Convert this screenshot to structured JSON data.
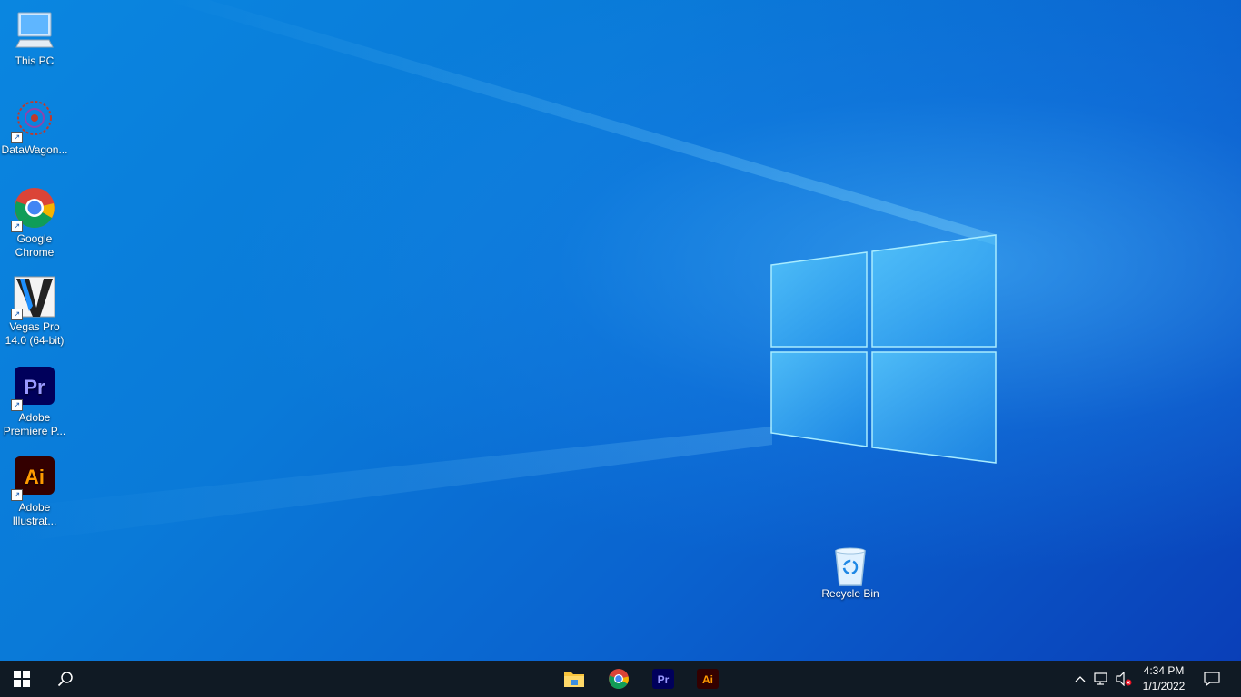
{
  "desktop": {
    "icons": [
      {
        "label": "This PC",
        "icon": "computer-icon"
      },
      {
        "label": "DataWagon...",
        "icon": "datawagon-icon"
      },
      {
        "label": "Google Chrome",
        "icon": "chrome-icon"
      },
      {
        "label": "Vegas Pro 14.0 (64-bit)",
        "icon": "vegas-pro-icon"
      },
      {
        "label": "Adobe Premiere P...",
        "icon": "premiere-pro-icon",
        "badge": "Pr",
        "color": "#9999ff"
      },
      {
        "label": "Adobe Illustrat...",
        "icon": "illustrator-icon",
        "badge": "Ai",
        "color": "#ff9a00"
      }
    ],
    "recycle_bin": {
      "label": "Recycle Bin",
      "icon": "recycle-bin-icon"
    }
  },
  "taskbar": {
    "apps": [
      {
        "name": "file-explorer",
        "icon": "folder-icon"
      },
      {
        "name": "chrome",
        "icon": "chrome-icon"
      },
      {
        "name": "premiere-pro",
        "icon": "premiere-pro-icon",
        "badge": "Pr"
      },
      {
        "name": "illustrator",
        "icon": "illustrator-icon",
        "badge": "Ai"
      }
    ],
    "tray": {
      "time": "4:34 PM",
      "date": "1/1/2022"
    }
  },
  "colors": {
    "taskbar": "#101a24",
    "desktop_blue": "#0a78d8",
    "premiere_bg": "#00005b",
    "illustrator_bg": "#330000"
  }
}
